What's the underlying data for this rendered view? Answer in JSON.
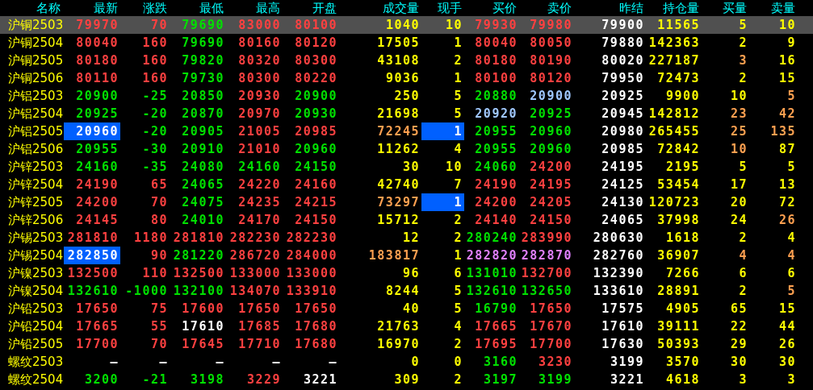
{
  "columns": [
    "名称",
    "最新",
    "涨跌",
    "最低",
    "最高",
    "开盘",
    "成交量",
    "现手",
    "买价",
    "卖价",
    "昨结",
    "持仓量",
    "买量",
    "卖量"
  ],
  "rows": [
    {
      "name": "沪铜2503",
      "selected": true,
      "cells": [
        {
          "text": "79970",
          "color": "#ff4040",
          "flash": false
        },
        {
          "text": "70",
          "color": "#ff4040",
          "flash": false
        },
        {
          "text": "79690",
          "color": "#00e000",
          "flash": false
        },
        {
          "text": "83000",
          "color": "#ff4040",
          "flash": false
        },
        {
          "text": "80100",
          "color": "#ff4040",
          "flash": false
        },
        {
          "text": "1040",
          "color": "#ffff00",
          "flash": false
        },
        {
          "text": "10",
          "color": "#ffff00",
          "flash": false
        },
        {
          "text": "79930",
          "color": "#ff4040",
          "flash": false
        },
        {
          "text": "79980",
          "color": "#ff4040",
          "flash": false
        },
        {
          "text": "79900",
          "color": "#ffffff",
          "flash": false
        },
        {
          "text": "11565",
          "color": "#ffff00",
          "flash": false
        },
        {
          "text": "5",
          "color": "#ffff00",
          "flash": false
        },
        {
          "text": "10",
          "color": "#ffff00",
          "flash": false
        }
      ]
    },
    {
      "name": "沪铜2504",
      "selected": false,
      "cells": [
        {
          "text": "80040",
          "color": "#ff4040",
          "flash": false
        },
        {
          "text": "160",
          "color": "#ff4040",
          "flash": false
        },
        {
          "text": "79690",
          "color": "#00e000",
          "flash": false
        },
        {
          "text": "80160",
          "color": "#ff4040",
          "flash": false
        },
        {
          "text": "80120",
          "color": "#ff4040",
          "flash": false
        },
        {
          "text": "17505",
          "color": "#ffff00",
          "flash": false
        },
        {
          "text": "1",
          "color": "#ffff00",
          "flash": false
        },
        {
          "text": "80040",
          "color": "#ff4040",
          "flash": false
        },
        {
          "text": "80050",
          "color": "#ff4040",
          "flash": false
        },
        {
          "text": "79880",
          "color": "#ffffff",
          "flash": false
        },
        {
          "text": "142363",
          "color": "#ffff00",
          "flash": false
        },
        {
          "text": "2",
          "color": "#ffff00",
          "flash": false
        },
        {
          "text": "9",
          "color": "#ffff00",
          "flash": false
        }
      ]
    },
    {
      "name": "沪铜2505",
      "selected": false,
      "cells": [
        {
          "text": "80180",
          "color": "#ff4040",
          "flash": false
        },
        {
          "text": "160",
          "color": "#ff4040",
          "flash": false
        },
        {
          "text": "79820",
          "color": "#00e000",
          "flash": false
        },
        {
          "text": "80320",
          "color": "#ff4040",
          "flash": false
        },
        {
          "text": "80300",
          "color": "#ff4040",
          "flash": false
        },
        {
          "text": "43108",
          "color": "#ffff00",
          "flash": false
        },
        {
          "text": "2",
          "color": "#ffff00",
          "flash": false
        },
        {
          "text": "80180",
          "color": "#ff4040",
          "flash": false
        },
        {
          "text": "80190",
          "color": "#ff4040",
          "flash": false
        },
        {
          "text": "80020",
          "color": "#ffffff",
          "flash": false
        },
        {
          "text": "227187",
          "color": "#ffff00",
          "flash": false
        },
        {
          "text": "3",
          "color": "#ffa050",
          "flash": false
        },
        {
          "text": "16",
          "color": "#ffff00",
          "flash": false
        }
      ]
    },
    {
      "name": "沪铜2506",
      "selected": false,
      "cells": [
        {
          "text": "80110",
          "color": "#ff4040",
          "flash": false
        },
        {
          "text": "160",
          "color": "#ff4040",
          "flash": false
        },
        {
          "text": "79730",
          "color": "#00e000",
          "flash": false
        },
        {
          "text": "80300",
          "color": "#ff4040",
          "flash": false
        },
        {
          "text": "80220",
          "color": "#ff4040",
          "flash": false
        },
        {
          "text": "9036",
          "color": "#ffff00",
          "flash": false
        },
        {
          "text": "1",
          "color": "#ffff00",
          "flash": false
        },
        {
          "text": "80100",
          "color": "#ff4040",
          "flash": false
        },
        {
          "text": "80120",
          "color": "#ff4040",
          "flash": false
        },
        {
          "text": "79950",
          "color": "#ffffff",
          "flash": false
        },
        {
          "text": "72473",
          "color": "#ffff00",
          "flash": false
        },
        {
          "text": "2",
          "color": "#ffff00",
          "flash": false
        },
        {
          "text": "15",
          "color": "#ffff00",
          "flash": false
        }
      ]
    },
    {
      "name": "沪铝2503",
      "selected": false,
      "cells": [
        {
          "text": "20900",
          "color": "#00e000",
          "flash": false
        },
        {
          "text": "-25",
          "color": "#00e000",
          "flash": false
        },
        {
          "text": "20850",
          "color": "#00e000",
          "flash": false
        },
        {
          "text": "20930",
          "color": "#ff4040",
          "flash": false
        },
        {
          "text": "20900",
          "color": "#00e000",
          "flash": false
        },
        {
          "text": "250",
          "color": "#ffff00",
          "flash": false
        },
        {
          "text": "5",
          "color": "#ffff00",
          "flash": false
        },
        {
          "text": "20880",
          "color": "#00e000",
          "flash": false
        },
        {
          "text": "20900",
          "color": "#a0c8ff",
          "flash": false
        },
        {
          "text": "20925",
          "color": "#ffffff",
          "flash": false
        },
        {
          "text": "9900",
          "color": "#ffff00",
          "flash": false
        },
        {
          "text": "10",
          "color": "#ffff00",
          "flash": false
        },
        {
          "text": "5",
          "color": "#ffa050",
          "flash": false
        }
      ]
    },
    {
      "name": "沪铝2504",
      "selected": false,
      "cells": [
        {
          "text": "20925",
          "color": "#00e000",
          "flash": false
        },
        {
          "text": "-20",
          "color": "#00e000",
          "flash": false
        },
        {
          "text": "20870",
          "color": "#00e000",
          "flash": false
        },
        {
          "text": "20970",
          "color": "#ff4040",
          "flash": false
        },
        {
          "text": "20930",
          "color": "#00e000",
          "flash": false
        },
        {
          "text": "21698",
          "color": "#ffff00",
          "flash": false
        },
        {
          "text": "5",
          "color": "#ffff00",
          "flash": false
        },
        {
          "text": "20920",
          "color": "#a0c8ff",
          "flash": false
        },
        {
          "text": "20925",
          "color": "#00e000",
          "flash": false
        },
        {
          "text": "20945",
          "color": "#ffffff",
          "flash": false
        },
        {
          "text": "142812",
          "color": "#ffff00",
          "flash": false
        },
        {
          "text": "23",
          "color": "#ffa050",
          "flash": false
        },
        {
          "text": "42",
          "color": "#ffa050",
          "flash": false
        }
      ]
    },
    {
      "name": "沪铝2505",
      "selected": false,
      "cells": [
        {
          "text": "20960",
          "color": "#ffffff",
          "flash": true
        },
        {
          "text": "-20",
          "color": "#00e000",
          "flash": false
        },
        {
          "text": "20905",
          "color": "#00e000",
          "flash": false
        },
        {
          "text": "21005",
          "color": "#ff4040",
          "flash": false
        },
        {
          "text": "20985",
          "color": "#ff4040",
          "flash": false
        },
        {
          "text": "72245",
          "color": "#ffa050",
          "flash": false
        },
        {
          "text": "1",
          "color": "#ffffff",
          "flash": true
        },
        {
          "text": "20955",
          "color": "#00e000",
          "flash": false
        },
        {
          "text": "20960",
          "color": "#00e000",
          "flash": false
        },
        {
          "text": "20980",
          "color": "#ffffff",
          "flash": false
        },
        {
          "text": "265455",
          "color": "#ffff00",
          "flash": false
        },
        {
          "text": "25",
          "color": "#ffa050",
          "flash": false
        },
        {
          "text": "135",
          "color": "#ffa050",
          "flash": false
        }
      ]
    },
    {
      "name": "沪铝2506",
      "selected": false,
      "cells": [
        {
          "text": "20955",
          "color": "#00e000",
          "flash": false
        },
        {
          "text": "-30",
          "color": "#00e000",
          "flash": false
        },
        {
          "text": "20910",
          "color": "#00e000",
          "flash": false
        },
        {
          "text": "21010",
          "color": "#ff4040",
          "flash": false
        },
        {
          "text": "20960",
          "color": "#00e000",
          "flash": false
        },
        {
          "text": "11262",
          "color": "#ffff00",
          "flash": false
        },
        {
          "text": "4",
          "color": "#ffff00",
          "flash": false
        },
        {
          "text": "20955",
          "color": "#00e000",
          "flash": false
        },
        {
          "text": "20960",
          "color": "#00e000",
          "flash": false
        },
        {
          "text": "20985",
          "color": "#ffffff",
          "flash": false
        },
        {
          "text": "72842",
          "color": "#ffff00",
          "flash": false
        },
        {
          "text": "10",
          "color": "#ffa050",
          "flash": false
        },
        {
          "text": "87",
          "color": "#ffff00",
          "flash": false
        }
      ]
    },
    {
      "name": "沪锌2503",
      "selected": false,
      "cells": [
        {
          "text": "24160",
          "color": "#00e000",
          "flash": false
        },
        {
          "text": "-35",
          "color": "#00e000",
          "flash": false
        },
        {
          "text": "24080",
          "color": "#00e000",
          "flash": false
        },
        {
          "text": "24160",
          "color": "#00e000",
          "flash": false
        },
        {
          "text": "24150",
          "color": "#00e000",
          "flash": false
        },
        {
          "text": "30",
          "color": "#ffff00",
          "flash": false
        },
        {
          "text": "10",
          "color": "#ffff00",
          "flash": false
        },
        {
          "text": "24060",
          "color": "#00e000",
          "flash": false
        },
        {
          "text": "24200",
          "color": "#ff4040",
          "flash": false
        },
        {
          "text": "24195",
          "color": "#ffffff",
          "flash": false
        },
        {
          "text": "2195",
          "color": "#ffff00",
          "flash": false
        },
        {
          "text": "5",
          "color": "#ffff00",
          "flash": false
        },
        {
          "text": "5",
          "color": "#ffff00",
          "flash": false
        }
      ]
    },
    {
      "name": "沪锌2504",
      "selected": false,
      "cells": [
        {
          "text": "24190",
          "color": "#ff4040",
          "flash": false
        },
        {
          "text": "65",
          "color": "#ff4040",
          "flash": false
        },
        {
          "text": "24065",
          "color": "#00e000",
          "flash": false
        },
        {
          "text": "24220",
          "color": "#ff4040",
          "flash": false
        },
        {
          "text": "24160",
          "color": "#ff4040",
          "flash": false
        },
        {
          "text": "42740",
          "color": "#ffff00",
          "flash": false
        },
        {
          "text": "7",
          "color": "#ffff00",
          "flash": false
        },
        {
          "text": "24190",
          "color": "#ff4040",
          "flash": false
        },
        {
          "text": "24195",
          "color": "#ff4040",
          "flash": false
        },
        {
          "text": "24125",
          "color": "#ffffff",
          "flash": false
        },
        {
          "text": "53454",
          "color": "#ffff00",
          "flash": false
        },
        {
          "text": "17",
          "color": "#ffff00",
          "flash": false
        },
        {
          "text": "13",
          "color": "#ffff00",
          "flash": false
        }
      ]
    },
    {
      "name": "沪锌2505",
      "selected": false,
      "cells": [
        {
          "text": "24200",
          "color": "#ff4040",
          "flash": false
        },
        {
          "text": "70",
          "color": "#ff4040",
          "flash": false
        },
        {
          "text": "24075",
          "color": "#00e000",
          "flash": false
        },
        {
          "text": "24235",
          "color": "#ff4040",
          "flash": false
        },
        {
          "text": "24215",
          "color": "#ff4040",
          "flash": false
        },
        {
          "text": "73297",
          "color": "#ffa050",
          "flash": false
        },
        {
          "text": "1",
          "color": "#ffffff",
          "flash": true
        },
        {
          "text": "24200",
          "color": "#ff4040",
          "flash": false
        },
        {
          "text": "24205",
          "color": "#ff4040",
          "flash": false
        },
        {
          "text": "24130",
          "color": "#ffffff",
          "flash": false
        },
        {
          "text": "120723",
          "color": "#ffff00",
          "flash": false
        },
        {
          "text": "20",
          "color": "#ffff00",
          "flash": false
        },
        {
          "text": "72",
          "color": "#ffff00",
          "flash": false
        }
      ]
    },
    {
      "name": "沪锌2506",
      "selected": false,
      "cells": [
        {
          "text": "24145",
          "color": "#ff4040",
          "flash": false
        },
        {
          "text": "80",
          "color": "#ff4040",
          "flash": false
        },
        {
          "text": "24010",
          "color": "#00e000",
          "flash": false
        },
        {
          "text": "24170",
          "color": "#ff4040",
          "flash": false
        },
        {
          "text": "24150",
          "color": "#ff4040",
          "flash": false
        },
        {
          "text": "15712",
          "color": "#ffff00",
          "flash": false
        },
        {
          "text": "2",
          "color": "#ffff00",
          "flash": false
        },
        {
          "text": "24140",
          "color": "#ff4040",
          "flash": false
        },
        {
          "text": "24150",
          "color": "#ff4040",
          "flash": false
        },
        {
          "text": "24065",
          "color": "#ffffff",
          "flash": false
        },
        {
          "text": "37998",
          "color": "#ffff00",
          "flash": false
        },
        {
          "text": "24",
          "color": "#ffff00",
          "flash": false
        },
        {
          "text": "26",
          "color": "#ffa050",
          "flash": false
        }
      ]
    },
    {
      "name": "沪锡2503",
      "selected": false,
      "cells": [
        {
          "text": "281810",
          "color": "#ff4040",
          "flash": false
        },
        {
          "text": "1180",
          "color": "#ff4040",
          "flash": false
        },
        {
          "text": "281810",
          "color": "#ff4040",
          "flash": false
        },
        {
          "text": "282230",
          "color": "#ff4040",
          "flash": false
        },
        {
          "text": "282230",
          "color": "#ff4040",
          "flash": false
        },
        {
          "text": "12",
          "color": "#ffff00",
          "flash": false
        },
        {
          "text": "2",
          "color": "#ffff00",
          "flash": false
        },
        {
          "text": "280240",
          "color": "#00e000",
          "flash": false
        },
        {
          "text": "283990",
          "color": "#ff4040",
          "flash": false
        },
        {
          "text": "280630",
          "color": "#ffffff",
          "flash": false
        },
        {
          "text": "1618",
          "color": "#ffff00",
          "flash": false
        },
        {
          "text": "2",
          "color": "#ffff00",
          "flash": false
        },
        {
          "text": "4",
          "color": "#ffff00",
          "flash": false
        }
      ]
    },
    {
      "name": "沪锡2504",
      "selected": false,
      "cells": [
        {
          "text": "282850",
          "color": "#ffffff",
          "flash": true
        },
        {
          "text": "90",
          "color": "#ff4040",
          "flash": false
        },
        {
          "text": "281220",
          "color": "#00e000",
          "flash": false
        },
        {
          "text": "286720",
          "color": "#ff4040",
          "flash": false
        },
        {
          "text": "284000",
          "color": "#ff4040",
          "flash": false
        },
        {
          "text": "183817",
          "color": "#ffa050",
          "flash": false
        },
        {
          "text": "1",
          "color": "#ffff00",
          "flash": false
        },
        {
          "text": "282820",
          "color": "#e080ff",
          "flash": false
        },
        {
          "text": "282870",
          "color": "#e080ff",
          "flash": false
        },
        {
          "text": "282760",
          "color": "#ffffff",
          "flash": false
        },
        {
          "text": "36907",
          "color": "#ffff00",
          "flash": false
        },
        {
          "text": "4",
          "color": "#ffa050",
          "flash": false
        },
        {
          "text": "4",
          "color": "#ffa050",
          "flash": false
        }
      ]
    },
    {
      "name": "沪镍2503",
      "selected": false,
      "cells": [
        {
          "text": "132500",
          "color": "#ff4040",
          "flash": false
        },
        {
          "text": "110",
          "color": "#ff4040",
          "flash": false
        },
        {
          "text": "132500",
          "color": "#ff4040",
          "flash": false
        },
        {
          "text": "133000",
          "color": "#ff4040",
          "flash": false
        },
        {
          "text": "133000",
          "color": "#ff4040",
          "flash": false
        },
        {
          "text": "96",
          "color": "#ffff00",
          "flash": false
        },
        {
          "text": "6",
          "color": "#ffff00",
          "flash": false
        },
        {
          "text": "131010",
          "color": "#00e000",
          "flash": false
        },
        {
          "text": "132700",
          "color": "#ff4040",
          "flash": false
        },
        {
          "text": "132390",
          "color": "#ffffff",
          "flash": false
        },
        {
          "text": "7266",
          "color": "#ffff00",
          "flash": false
        },
        {
          "text": "6",
          "color": "#ffff00",
          "flash": false
        },
        {
          "text": "6",
          "color": "#ffff00",
          "flash": false
        }
      ]
    },
    {
      "name": "沪镍2504",
      "selected": false,
      "cells": [
        {
          "text": "132610",
          "color": "#00e000",
          "flash": false
        },
        {
          "text": "-1000",
          "color": "#00e000",
          "flash": false
        },
        {
          "text": "132100",
          "color": "#00e000",
          "flash": false
        },
        {
          "text": "134070",
          "color": "#ff4040",
          "flash": false
        },
        {
          "text": "133910",
          "color": "#ff4040",
          "flash": false
        },
        {
          "text": "8244",
          "color": "#ffff00",
          "flash": false
        },
        {
          "text": "5",
          "color": "#ffff00",
          "flash": false
        },
        {
          "text": "132610",
          "color": "#00e000",
          "flash": false
        },
        {
          "text": "132650",
          "color": "#00e000",
          "flash": false
        },
        {
          "text": "133610",
          "color": "#ffffff",
          "flash": false
        },
        {
          "text": "28891",
          "color": "#ffff00",
          "flash": false
        },
        {
          "text": "2",
          "color": "#ffff00",
          "flash": false
        },
        {
          "text": "5",
          "color": "#ffa050",
          "flash": false
        }
      ]
    },
    {
      "name": "沪铅2503",
      "selected": false,
      "cells": [
        {
          "text": "17650",
          "color": "#ff4040",
          "flash": false
        },
        {
          "text": "75",
          "color": "#ff4040",
          "flash": false
        },
        {
          "text": "17600",
          "color": "#ff4040",
          "flash": false
        },
        {
          "text": "17650",
          "color": "#ff4040",
          "flash": false
        },
        {
          "text": "17650",
          "color": "#ff4040",
          "flash": false
        },
        {
          "text": "40",
          "color": "#ffff00",
          "flash": false
        },
        {
          "text": "5",
          "color": "#ffff00",
          "flash": false
        },
        {
          "text": "16790",
          "color": "#00e000",
          "flash": false
        },
        {
          "text": "17650",
          "color": "#ff4040",
          "flash": false
        },
        {
          "text": "17575",
          "color": "#ffffff",
          "flash": false
        },
        {
          "text": "4905",
          "color": "#ffff00",
          "flash": false
        },
        {
          "text": "65",
          "color": "#ffff00",
          "flash": false
        },
        {
          "text": "15",
          "color": "#ffff00",
          "flash": false
        }
      ]
    },
    {
      "name": "沪铅2504",
      "selected": false,
      "cells": [
        {
          "text": "17665",
          "color": "#ff4040",
          "flash": false
        },
        {
          "text": "55",
          "color": "#ff4040",
          "flash": false
        },
        {
          "text": "17610",
          "color": "#ffffff",
          "flash": false
        },
        {
          "text": "17685",
          "color": "#ff4040",
          "flash": false
        },
        {
          "text": "17680",
          "color": "#ff4040",
          "flash": false
        },
        {
          "text": "21763",
          "color": "#ffff00",
          "flash": false
        },
        {
          "text": "4",
          "color": "#ffff00",
          "flash": false
        },
        {
          "text": "17665",
          "color": "#ff4040",
          "flash": false
        },
        {
          "text": "17670",
          "color": "#ff4040",
          "flash": false
        },
        {
          "text": "17610",
          "color": "#ffffff",
          "flash": false
        },
        {
          "text": "39111",
          "color": "#ffff00",
          "flash": false
        },
        {
          "text": "22",
          "color": "#ffff00",
          "flash": false
        },
        {
          "text": "44",
          "color": "#ffff00",
          "flash": false
        }
      ]
    },
    {
      "name": "沪铅2505",
      "selected": false,
      "cells": [
        {
          "text": "17700",
          "color": "#ff4040",
          "flash": false
        },
        {
          "text": "70",
          "color": "#ff4040",
          "flash": false
        },
        {
          "text": "17645",
          "color": "#ff4040",
          "flash": false
        },
        {
          "text": "17710",
          "color": "#ff4040",
          "flash": false
        },
        {
          "text": "17680",
          "color": "#ff4040",
          "flash": false
        },
        {
          "text": "16970",
          "color": "#ffff00",
          "flash": false
        },
        {
          "text": "2",
          "color": "#ffff00",
          "flash": false
        },
        {
          "text": "17695",
          "color": "#ff4040",
          "flash": false
        },
        {
          "text": "17700",
          "color": "#ff4040",
          "flash": false
        },
        {
          "text": "17630",
          "color": "#ffffff",
          "flash": false
        },
        {
          "text": "50393",
          "color": "#ffff00",
          "flash": false
        },
        {
          "text": "29",
          "color": "#ffff00",
          "flash": false
        },
        {
          "text": "26",
          "color": "#ffff00",
          "flash": false
        }
      ]
    },
    {
      "name": "螺纹2503",
      "selected": false,
      "cells": [
        {
          "text": "—",
          "color": "#ffffff",
          "flash": false
        },
        {
          "text": "—",
          "color": "#ffffff",
          "flash": false
        },
        {
          "text": "—",
          "color": "#ffffff",
          "flash": false
        },
        {
          "text": "—",
          "color": "#ffffff",
          "flash": false
        },
        {
          "text": "—",
          "color": "#ffffff",
          "flash": false
        },
        {
          "text": "0",
          "color": "#ffff00",
          "flash": false
        },
        {
          "text": "0",
          "color": "#ffff00",
          "flash": false
        },
        {
          "text": "3160",
          "color": "#00e000",
          "flash": false
        },
        {
          "text": "3230",
          "color": "#ff4040",
          "flash": false
        },
        {
          "text": "3199",
          "color": "#ffffff",
          "flash": false
        },
        {
          "text": "3570",
          "color": "#ffff00",
          "flash": false
        },
        {
          "text": "30",
          "color": "#ffff00",
          "flash": false
        },
        {
          "text": "30",
          "color": "#ffff00",
          "flash": false
        }
      ]
    },
    {
      "name": "螺纹2504",
      "selected": false,
      "cells": [
        {
          "text": "3200",
          "color": "#00e000",
          "flash": false
        },
        {
          "text": "-21",
          "color": "#00e000",
          "flash": false
        },
        {
          "text": "3198",
          "color": "#00e000",
          "flash": false
        },
        {
          "text": "3229",
          "color": "#ff4040",
          "flash": false
        },
        {
          "text": "3221",
          "color": "#ffffff",
          "flash": false
        },
        {
          "text": "309",
          "color": "#ffff00",
          "flash": false
        },
        {
          "text": "2",
          "color": "#ffff00",
          "flash": false
        },
        {
          "text": "3197",
          "color": "#00e000",
          "flash": false
        },
        {
          "text": "3199",
          "color": "#00e000",
          "flash": false
        },
        {
          "text": "3221",
          "color": "#ffffff",
          "flash": false
        },
        {
          "text": "4618",
          "color": "#ffff00",
          "flash": false
        },
        {
          "text": "3",
          "color": "#ffff00",
          "flash": false
        },
        {
          "text": "3",
          "color": "#ffff00",
          "flash": false
        }
      ]
    }
  ]
}
